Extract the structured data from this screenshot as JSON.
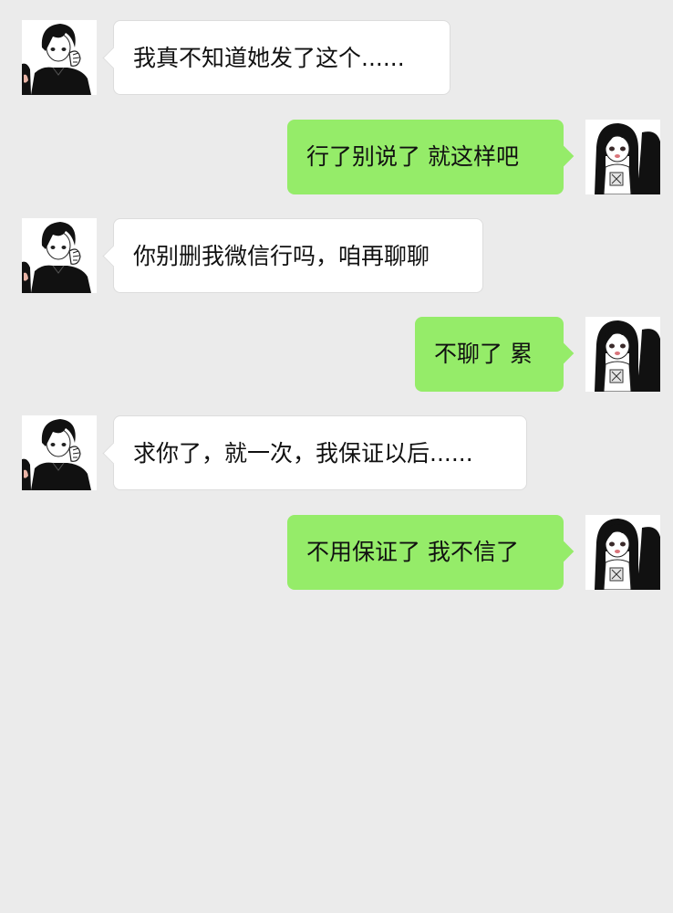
{
  "chat": {
    "messages": [
      {
        "side": "left",
        "text": "我真不知道她发了这个......"
      },
      {
        "side": "right",
        "text": "行了别说了 就这样吧"
      },
      {
        "side": "left",
        "text": "你别删我微信行吗，咱再聊聊"
      },
      {
        "side": "right",
        "text": "不聊了 累"
      },
      {
        "side": "left",
        "text": "求你了，就一次，我保证以后......"
      },
      {
        "side": "right",
        "text": "不用保证了 我不信了"
      }
    ]
  },
  "colors": {
    "background": "#ebebeb",
    "incoming_bubble": "#ffffff",
    "outgoing_bubble": "#95ec69",
    "text": "#111111"
  },
  "icons": {
    "left_avatar": "boy-avatar-icon",
    "right_avatar": "girl-avatar-icon"
  }
}
